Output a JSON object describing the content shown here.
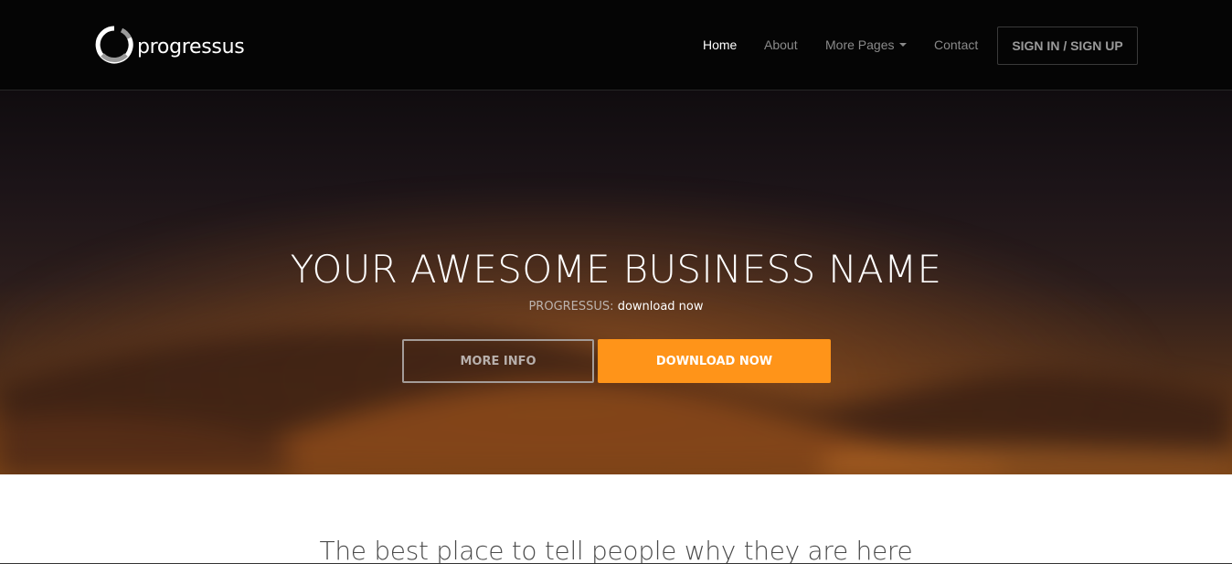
{
  "brand": {
    "name": "progressus",
    "logo_icon": "ring-logo-icon"
  },
  "nav": {
    "items": [
      {
        "label": "Home",
        "active": true
      },
      {
        "label": "About",
        "active": false
      },
      {
        "label": "More Pages",
        "active": false,
        "has_dropdown": true
      },
      {
        "label": "Contact",
        "active": false
      }
    ],
    "signin_label": "SIGN IN / SIGN UP"
  },
  "hero": {
    "title": "YOUR AWESOME BUSINESS NAME",
    "subtitle_brand": "PROGRESSUS:",
    "subtitle_rest": "download now",
    "more_info_label": "MORE INFO",
    "download_label": "DOWNLOAD NOW"
  },
  "content": {
    "tagline": "The best place to tell people why they are here"
  },
  "colors": {
    "navbar_bg": "#050505",
    "accent_orange": "#ff9419",
    "text_white": "#ffffff"
  }
}
